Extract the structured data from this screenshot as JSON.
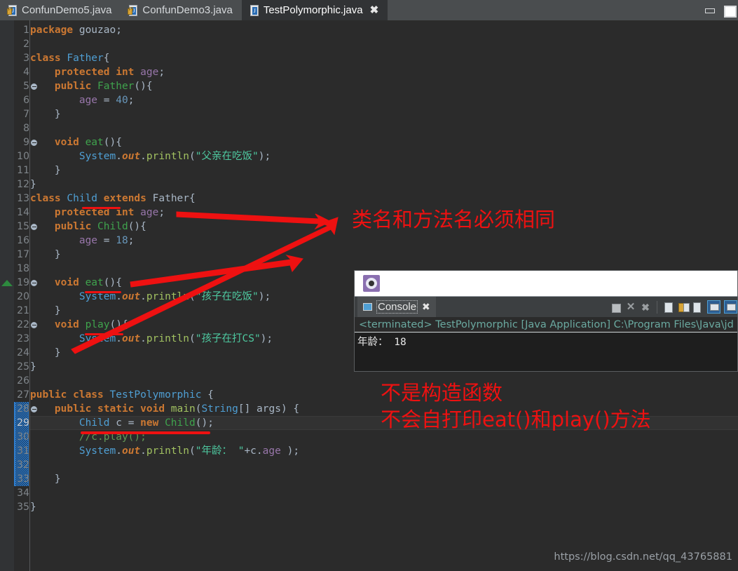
{
  "window": {
    "minimize_label": "minimize",
    "maximize_label": "maximize"
  },
  "tabs": [
    {
      "label": "ConfunDemo5.java",
      "active": false,
      "icon": "java-file-locked-icon"
    },
    {
      "label": "ConfunDemo3.java",
      "active": false,
      "icon": "java-file-locked-icon"
    },
    {
      "label": "TestPolymorphic.java",
      "active": true,
      "icon": "java-file-icon",
      "close": "✖"
    }
  ],
  "editor": {
    "current_line": 29,
    "selection_lines": [
      28,
      33
    ],
    "fold_lines": [
      5,
      9,
      15,
      19,
      22,
      28
    ],
    "override_marker_line": 19,
    "lines": [
      {
        "n": 1,
        "tokens": [
          {
            "t": "package ",
            "c": "kw"
          },
          {
            "t": "gouzao;",
            "c": "plain"
          }
        ]
      },
      {
        "n": 2,
        "tokens": []
      },
      {
        "n": 3,
        "tokens": [
          {
            "t": "class ",
            "c": "kw"
          },
          {
            "t": "Father",
            "c": "cls"
          },
          {
            "t": "{",
            "c": "plain"
          }
        ]
      },
      {
        "n": 4,
        "tokens": [
          {
            "t": "    ",
            "c": "plain"
          },
          {
            "t": "protected int ",
            "c": "kw"
          },
          {
            "t": "age",
            "c": "fld"
          },
          {
            "t": ";",
            "c": "plain"
          }
        ]
      },
      {
        "n": 5,
        "tokens": [
          {
            "t": "    ",
            "c": "plain"
          },
          {
            "t": "public ",
            "c": "kw"
          },
          {
            "t": "Father",
            "c": "clsg"
          },
          {
            "t": "(){",
            "c": "plain"
          }
        ]
      },
      {
        "n": 6,
        "tokens": [
          {
            "t": "        ",
            "c": "plain"
          },
          {
            "t": "age",
            "c": "fld"
          },
          {
            "t": " = ",
            "c": "plain"
          },
          {
            "t": "40",
            "c": "num"
          },
          {
            "t": ";",
            "c": "plain"
          }
        ]
      },
      {
        "n": 7,
        "tokens": [
          {
            "t": "    }",
            "c": "plain"
          }
        ]
      },
      {
        "n": 8,
        "tokens": []
      },
      {
        "n": 9,
        "tokens": [
          {
            "t": "    ",
            "c": "plain"
          },
          {
            "t": "void ",
            "c": "kw"
          },
          {
            "t": "eat",
            "c": "clsg"
          },
          {
            "t": "(){",
            "c": "plain"
          }
        ]
      },
      {
        "n": 10,
        "tokens": [
          {
            "t": "        ",
            "c": "plain"
          },
          {
            "t": "System",
            "c": "sys"
          },
          {
            "t": ".",
            "c": "plain"
          },
          {
            "t": "out",
            "c": "sout"
          },
          {
            "t": ".",
            "c": "plain"
          },
          {
            "t": "println",
            "c": "meth"
          },
          {
            "t": "(",
            "c": "plain"
          },
          {
            "t": "\"父亲在吃饭\"",
            "c": "strc"
          },
          {
            "t": ");",
            "c": "plain"
          }
        ]
      },
      {
        "n": 11,
        "tokens": [
          {
            "t": "    }",
            "c": "plain"
          }
        ]
      },
      {
        "n": 12,
        "tokens": [
          {
            "t": "}",
            "c": "plain"
          }
        ]
      },
      {
        "n": 13,
        "tokens": [
          {
            "t": "class ",
            "c": "kw"
          },
          {
            "t": "Child",
            "c": "cls"
          },
          {
            "t": " ",
            "c": "plain"
          },
          {
            "t": "extends ",
            "c": "kw"
          },
          {
            "t": "Father",
            "c": "type"
          },
          {
            "t": "{",
            "c": "plain"
          }
        ]
      },
      {
        "n": 14,
        "tokens": [
          {
            "t": "    ",
            "c": "plain"
          },
          {
            "t": "protected int ",
            "c": "kw"
          },
          {
            "t": "age",
            "c": "fld"
          },
          {
            "t": ";",
            "c": "plain"
          }
        ]
      },
      {
        "n": 15,
        "tokens": [
          {
            "t": "    ",
            "c": "plain"
          },
          {
            "t": "public ",
            "c": "kw"
          },
          {
            "t": "Child",
            "c": "clsg"
          },
          {
            "t": "(){",
            "c": "plain"
          }
        ]
      },
      {
        "n": 16,
        "tokens": [
          {
            "t": "        ",
            "c": "plain"
          },
          {
            "t": "age",
            "c": "fld"
          },
          {
            "t": " = ",
            "c": "plain"
          },
          {
            "t": "18",
            "c": "num"
          },
          {
            "t": ";",
            "c": "plain"
          }
        ]
      },
      {
        "n": 17,
        "tokens": [
          {
            "t": "    }",
            "c": "plain"
          }
        ]
      },
      {
        "n": 18,
        "tokens": []
      },
      {
        "n": 19,
        "tokens": [
          {
            "t": "    ",
            "c": "plain"
          },
          {
            "t": "void ",
            "c": "kw"
          },
          {
            "t": "eat",
            "c": "clsg"
          },
          {
            "t": "(){",
            "c": "plain"
          }
        ]
      },
      {
        "n": 20,
        "tokens": [
          {
            "t": "        ",
            "c": "plain"
          },
          {
            "t": "System",
            "c": "sys"
          },
          {
            "t": ".",
            "c": "plain"
          },
          {
            "t": "out",
            "c": "sout"
          },
          {
            "t": ".",
            "c": "plain"
          },
          {
            "t": "println",
            "c": "meth"
          },
          {
            "t": "(",
            "c": "plain"
          },
          {
            "t": "\"孩子在吃饭\"",
            "c": "strc"
          },
          {
            "t": ");",
            "c": "plain"
          }
        ]
      },
      {
        "n": 21,
        "tokens": [
          {
            "t": "    }",
            "c": "plain"
          }
        ]
      },
      {
        "n": 22,
        "tokens": [
          {
            "t": "    ",
            "c": "plain"
          },
          {
            "t": "void ",
            "c": "kw"
          },
          {
            "t": "play",
            "c": "clsg"
          },
          {
            "t": "(){",
            "c": "plain"
          }
        ]
      },
      {
        "n": 23,
        "tokens": [
          {
            "t": "        ",
            "c": "plain"
          },
          {
            "t": "System",
            "c": "sys"
          },
          {
            "t": ".",
            "c": "plain"
          },
          {
            "t": "out",
            "c": "sout"
          },
          {
            "t": ".",
            "c": "plain"
          },
          {
            "t": "println",
            "c": "meth"
          },
          {
            "t": "(",
            "c": "plain"
          },
          {
            "t": "\"孩子在打CS\"",
            "c": "strc"
          },
          {
            "t": ");",
            "c": "plain"
          }
        ]
      },
      {
        "n": 24,
        "tokens": [
          {
            "t": "    }",
            "c": "plain"
          }
        ]
      },
      {
        "n": 25,
        "tokens": [
          {
            "t": "}",
            "c": "plain"
          }
        ]
      },
      {
        "n": 26,
        "tokens": []
      },
      {
        "n": 27,
        "tokens": [
          {
            "t": "public class ",
            "c": "kw"
          },
          {
            "t": "TestPolymorphic",
            "c": "cls"
          },
          {
            "t": " {",
            "c": "plain"
          }
        ]
      },
      {
        "n": 28,
        "tokens": [
          {
            "t": "    ",
            "c": "plain"
          },
          {
            "t": "public static void ",
            "c": "kw"
          },
          {
            "t": "main",
            "c": "meth"
          },
          {
            "t": "(",
            "c": "plain"
          },
          {
            "t": "String",
            "c": "cls"
          },
          {
            "t": "[] args) {",
            "c": "plain"
          }
        ]
      },
      {
        "n": 29,
        "tokens": [
          {
            "t": "        ",
            "c": "plain"
          },
          {
            "t": "Child",
            "c": "cls"
          },
          {
            "t": " c = ",
            "c": "plain"
          },
          {
            "t": "new ",
            "c": "kw"
          },
          {
            "t": "Child",
            "c": "clsg"
          },
          {
            "t": "();",
            "c": "plain"
          }
        ]
      },
      {
        "n": 30,
        "tokens": [
          {
            "t": "        ",
            "c": "plain"
          },
          {
            "t": "//c.play();",
            "c": "cmt"
          }
        ]
      },
      {
        "n": 31,
        "tokens": [
          {
            "t": "        ",
            "c": "plain"
          },
          {
            "t": "System",
            "c": "sys"
          },
          {
            "t": ".",
            "c": "plain"
          },
          {
            "t": "out",
            "c": "sout"
          },
          {
            "t": ".",
            "c": "plain"
          },
          {
            "t": "println",
            "c": "meth"
          },
          {
            "t": "(",
            "c": "plain"
          },
          {
            "t": "\"年龄： \"",
            "c": "strc"
          },
          {
            "t": "+c.",
            "c": "plain"
          },
          {
            "t": "age",
            "c": "fld"
          },
          {
            "t": " );",
            "c": "plain"
          }
        ]
      },
      {
        "n": 32,
        "tokens": []
      },
      {
        "n": 33,
        "tokens": [
          {
            "t": "    }",
            "c": "plain"
          }
        ]
      },
      {
        "n": 34,
        "tokens": []
      },
      {
        "n": 35,
        "tokens": [
          {
            "t": "}",
            "c": "plain"
          }
        ]
      }
    ]
  },
  "annotations": {
    "color": "#ee1111",
    "note_classname": "类名和方法名必须相同",
    "note_not_constructor": "不是构造函数",
    "note_no_autoprint": "不会自打印eat()和play()方法",
    "underlines": [
      "Child (line 13)",
      "eat (line 19)",
      "play (line 22)",
      "Child c = new Child (line 29)",
      "console output"
    ],
    "arrow_count": 3
  },
  "console": {
    "panel_title": "Console",
    "close_glyph": "✖",
    "gear_icon": "gear-icon",
    "status": "<terminated> TestPolymorphic [Java Application] C:\\Program Files\\Java\\jd",
    "output": "年龄： 18",
    "toolbar": [
      {
        "name": "terminate-button",
        "glyph": ""
      },
      {
        "name": "remove-launch-button",
        "glyph": "✕"
      },
      {
        "name": "remove-all-terminated-button",
        "glyph": "✕"
      },
      {
        "name": "clear-console-button",
        "glyph": ""
      },
      {
        "name": "scroll-lock-button",
        "glyph": ""
      },
      {
        "name": "pin-console-button",
        "glyph": ""
      },
      {
        "name": "display-selected-console-button",
        "glyph": ""
      },
      {
        "name": "open-console-button",
        "glyph": ""
      }
    ]
  },
  "watermark": "https://blog.csdn.net/qq_43765881"
}
